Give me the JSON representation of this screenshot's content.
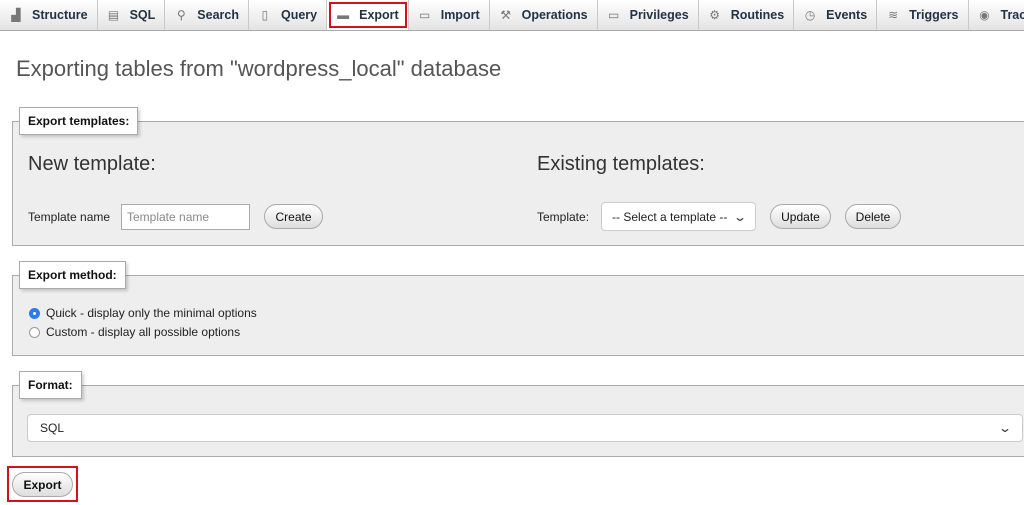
{
  "tabs": [
    {
      "name": "tab-structure",
      "icon": "structure-icon",
      "glyph": "▟",
      "label": "Structure"
    },
    {
      "name": "tab-sql",
      "icon": "sql-icon",
      "glyph": "▤",
      "label": "SQL"
    },
    {
      "name": "tab-search",
      "icon": "search-icon",
      "glyph": "⚲",
      "label": "Search"
    },
    {
      "name": "tab-query",
      "icon": "query-icon",
      "glyph": "▯",
      "label": "Query"
    },
    {
      "name": "tab-export",
      "icon": "export-icon",
      "glyph": "▬",
      "label": "Export",
      "active": true
    },
    {
      "name": "tab-import",
      "icon": "import-icon",
      "glyph": "▭",
      "label": "Import"
    },
    {
      "name": "tab-operations",
      "icon": "wrench-icon",
      "glyph": "⚒",
      "label": "Operations"
    },
    {
      "name": "tab-privileges",
      "icon": "privileges-icon",
      "glyph": "▭",
      "label": "Privileges"
    },
    {
      "name": "tab-routines",
      "icon": "routines-icon",
      "glyph": "⚙",
      "label": "Routines"
    },
    {
      "name": "tab-events",
      "icon": "clock-icon",
      "glyph": "◷",
      "label": "Events"
    },
    {
      "name": "tab-triggers",
      "icon": "triggers-icon",
      "glyph": "≋",
      "label": "Triggers"
    },
    {
      "name": "tab-tracking",
      "icon": "eye-icon",
      "glyph": "◉",
      "label": "Tracking"
    }
  ],
  "page_title": "Exporting tables from \"wordpress_local\" database",
  "templates": {
    "legend": "Export templates:",
    "new_heading": "New template:",
    "name_label": "Template name",
    "name_placeholder": "Template name",
    "create_label": "Create",
    "existing_heading": "Existing templates:",
    "template_label": "Template:",
    "select_value": "-- Select a template --",
    "update_label": "Update",
    "delete_label": "Delete"
  },
  "method": {
    "legend": "Export method:",
    "options": [
      {
        "label": "Quick - display only the minimal options",
        "checked": true
      },
      {
        "label": "Custom - display all possible options",
        "checked": false
      }
    ]
  },
  "format": {
    "legend": "Format:",
    "value": "SQL"
  },
  "submit_label": "Export",
  "colors": {
    "highlight": "#d0121c",
    "radio_accent": "#2b7de9"
  }
}
